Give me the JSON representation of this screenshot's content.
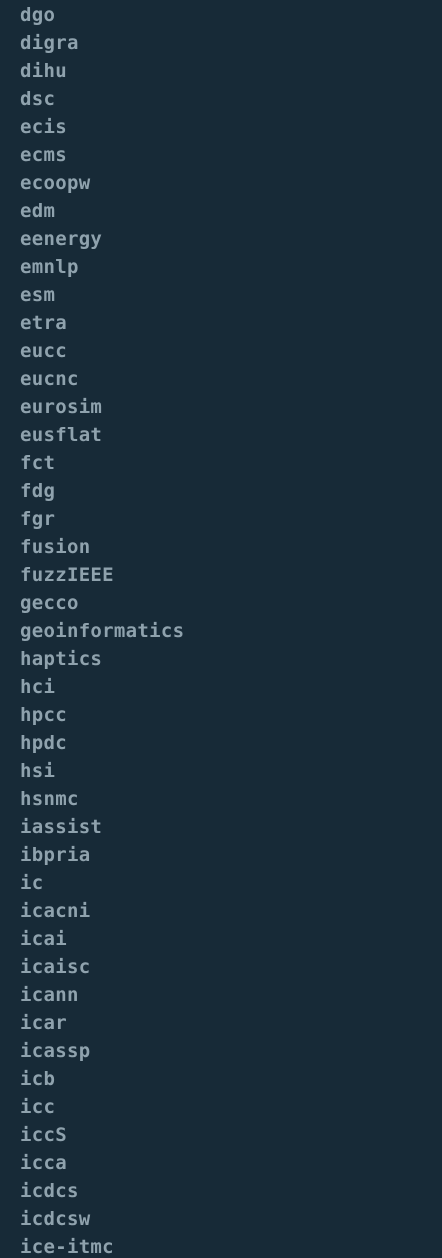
{
  "terminal": {
    "background": "#172a37",
    "text_color": "#8fa2ad",
    "lines": [
      "dgo",
      "digra",
      "dihu",
      "dsc",
      "ecis",
      "ecms",
      "ecoopw",
      "edm",
      "eenergy",
      "emnlp",
      "esm",
      "etra",
      "eucc",
      "eucnc",
      "eurosim",
      "eusflat",
      "fct",
      "fdg",
      "fgr",
      "fusion",
      "fuzzIEEE",
      "gecco",
      "geoinformatics",
      "haptics",
      "hci",
      "hpcc",
      "hpdc",
      "hsi",
      "hsnmc",
      "iassist",
      "ibpria",
      "ic",
      "icacni",
      "icai",
      "icaisc",
      "icann",
      "icar",
      "icassp",
      "icb",
      "icc",
      "iccS",
      "icca",
      "icdcs",
      "icdcsw",
      "ice-itmc"
    ]
  }
}
